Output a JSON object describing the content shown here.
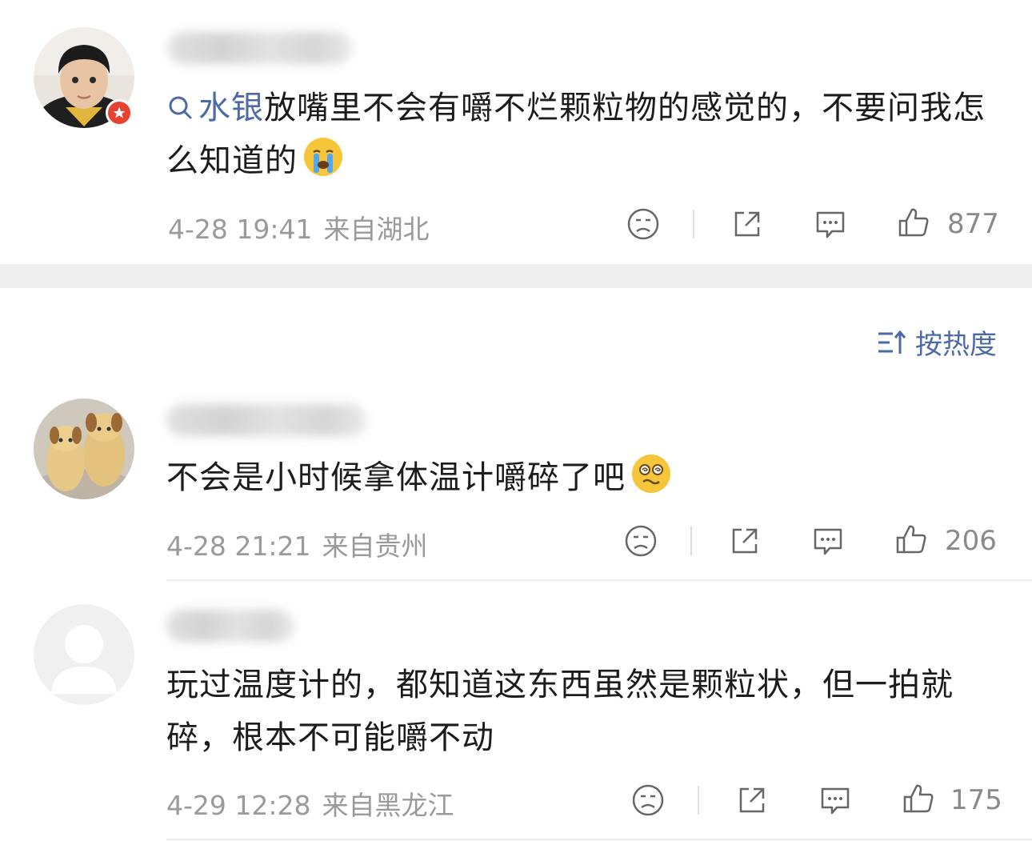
{
  "featured_comment": {
    "topic_link": "水银",
    "text_after_link": "放嘴里不会有嚼不烂颗粒物的感觉的，不要问我怎么知道的",
    "emoji": "crying-face",
    "time": "4-28 19:41",
    "location": "来自湖北",
    "likes": "877"
  },
  "sort": {
    "label": "按热度",
    "icon": "sort-icon"
  },
  "comments": [
    {
      "text": "不会是小时候拿体温计嚼碎了吧",
      "emoji": "dizzy-face",
      "time": "4-28 21:21",
      "location": "来自贵州",
      "likes": "206"
    },
    {
      "text": "玩过温度计的，都知道这东西虽然是颗粒状，但一拍就碎，根本不可能嚼不动",
      "time": "4-29 12:28",
      "location": "来自黑龙江",
      "likes": "175"
    }
  ],
  "colors": {
    "link": "#4d6aa8",
    "meta": "#9a9a9a",
    "badge": "#e5432f",
    "band": "#efefef"
  }
}
